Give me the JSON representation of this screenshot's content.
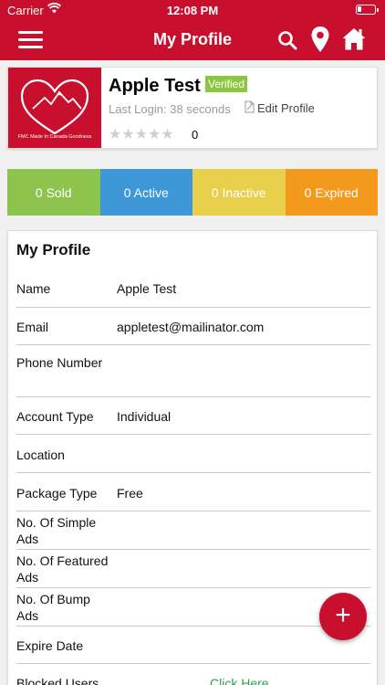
{
  "status_bar": {
    "carrier": "Carrier",
    "time": "12:08 PM"
  },
  "nav": {
    "title": "My Profile"
  },
  "profile": {
    "name": "Apple Test",
    "verified_badge": "Verified",
    "last_login": "Last Login: 38 seconds",
    "edit_label": "Edit Profile",
    "stars": "★★★★★",
    "rating_count": "0",
    "logo_text": "FMC Made In Canada Goodness"
  },
  "stats": [
    {
      "label": "0 Sold",
      "color": "#8dc44e"
    },
    {
      "label": "0 Active",
      "color": "#3e97d6"
    },
    {
      "label": "0 Inactive",
      "color": "#e8cf4c"
    },
    {
      "label": "0 Expired",
      "color": "#f39a1d"
    }
  ],
  "panel": {
    "title": "My Profile",
    "rows": [
      {
        "label": "Name",
        "value": "Apple Test"
      },
      {
        "label": "Email",
        "value": "appletest@mailinator.com"
      },
      {
        "label": "Phone Number",
        "value": ""
      },
      {
        "label": "Account Type",
        "value": "Individual"
      },
      {
        "label": "Location",
        "value": ""
      },
      {
        "label": "Package Type",
        "value": "Free"
      },
      {
        "label": "No. Of Simple Ads",
        "value": ""
      },
      {
        "label": "No. Of Featured Ads",
        "value": ""
      },
      {
        "label": "No. Of Bump Ads",
        "value": ""
      },
      {
        "label": "Expire Date",
        "value": ""
      },
      {
        "label": "Blocked Users",
        "value": "Click Here"
      }
    ]
  },
  "fab": {
    "label": "+"
  },
  "colors": {
    "brand": "#c8102e",
    "link": "#2aa04a",
    "verified": "#8cc63f"
  }
}
